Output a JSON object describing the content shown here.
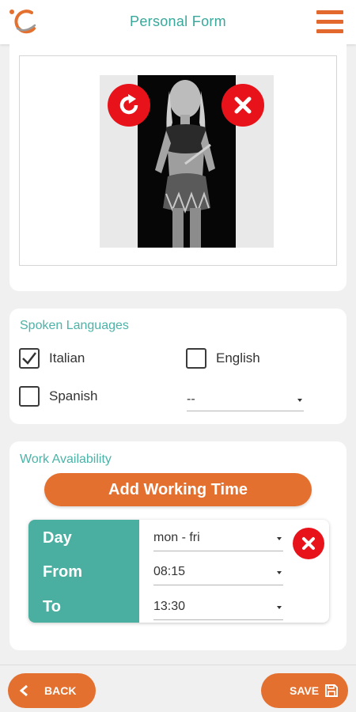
{
  "header": {
    "title": "Personal Form",
    "logo_icon": "brand-logo-icon",
    "menu_icon": "hamburger-menu-icon"
  },
  "photo": {
    "rotate_icon": "rotate-icon",
    "remove_icon": "close-icon"
  },
  "languages": {
    "section_title": "Spoken Languages",
    "items": [
      {
        "label": "Italian",
        "checked": true
      },
      {
        "label": "English",
        "checked": false
      },
      {
        "label": "Spanish",
        "checked": false
      }
    ],
    "other_select": {
      "value": "--"
    }
  },
  "work": {
    "section_title": "Work Availability",
    "add_button": "Add Working Time",
    "entry": {
      "day_label": "Day",
      "day_value": "mon - fri",
      "from_label": "From",
      "from_value": "08:15",
      "to_label": "To",
      "to_value": "13:30"
    }
  },
  "footer": {
    "back_label": "BACK",
    "save_label": "SAVE"
  },
  "colors": {
    "accent": "#e4702f",
    "teal": "#4aafa0",
    "danger": "#e8131a"
  }
}
